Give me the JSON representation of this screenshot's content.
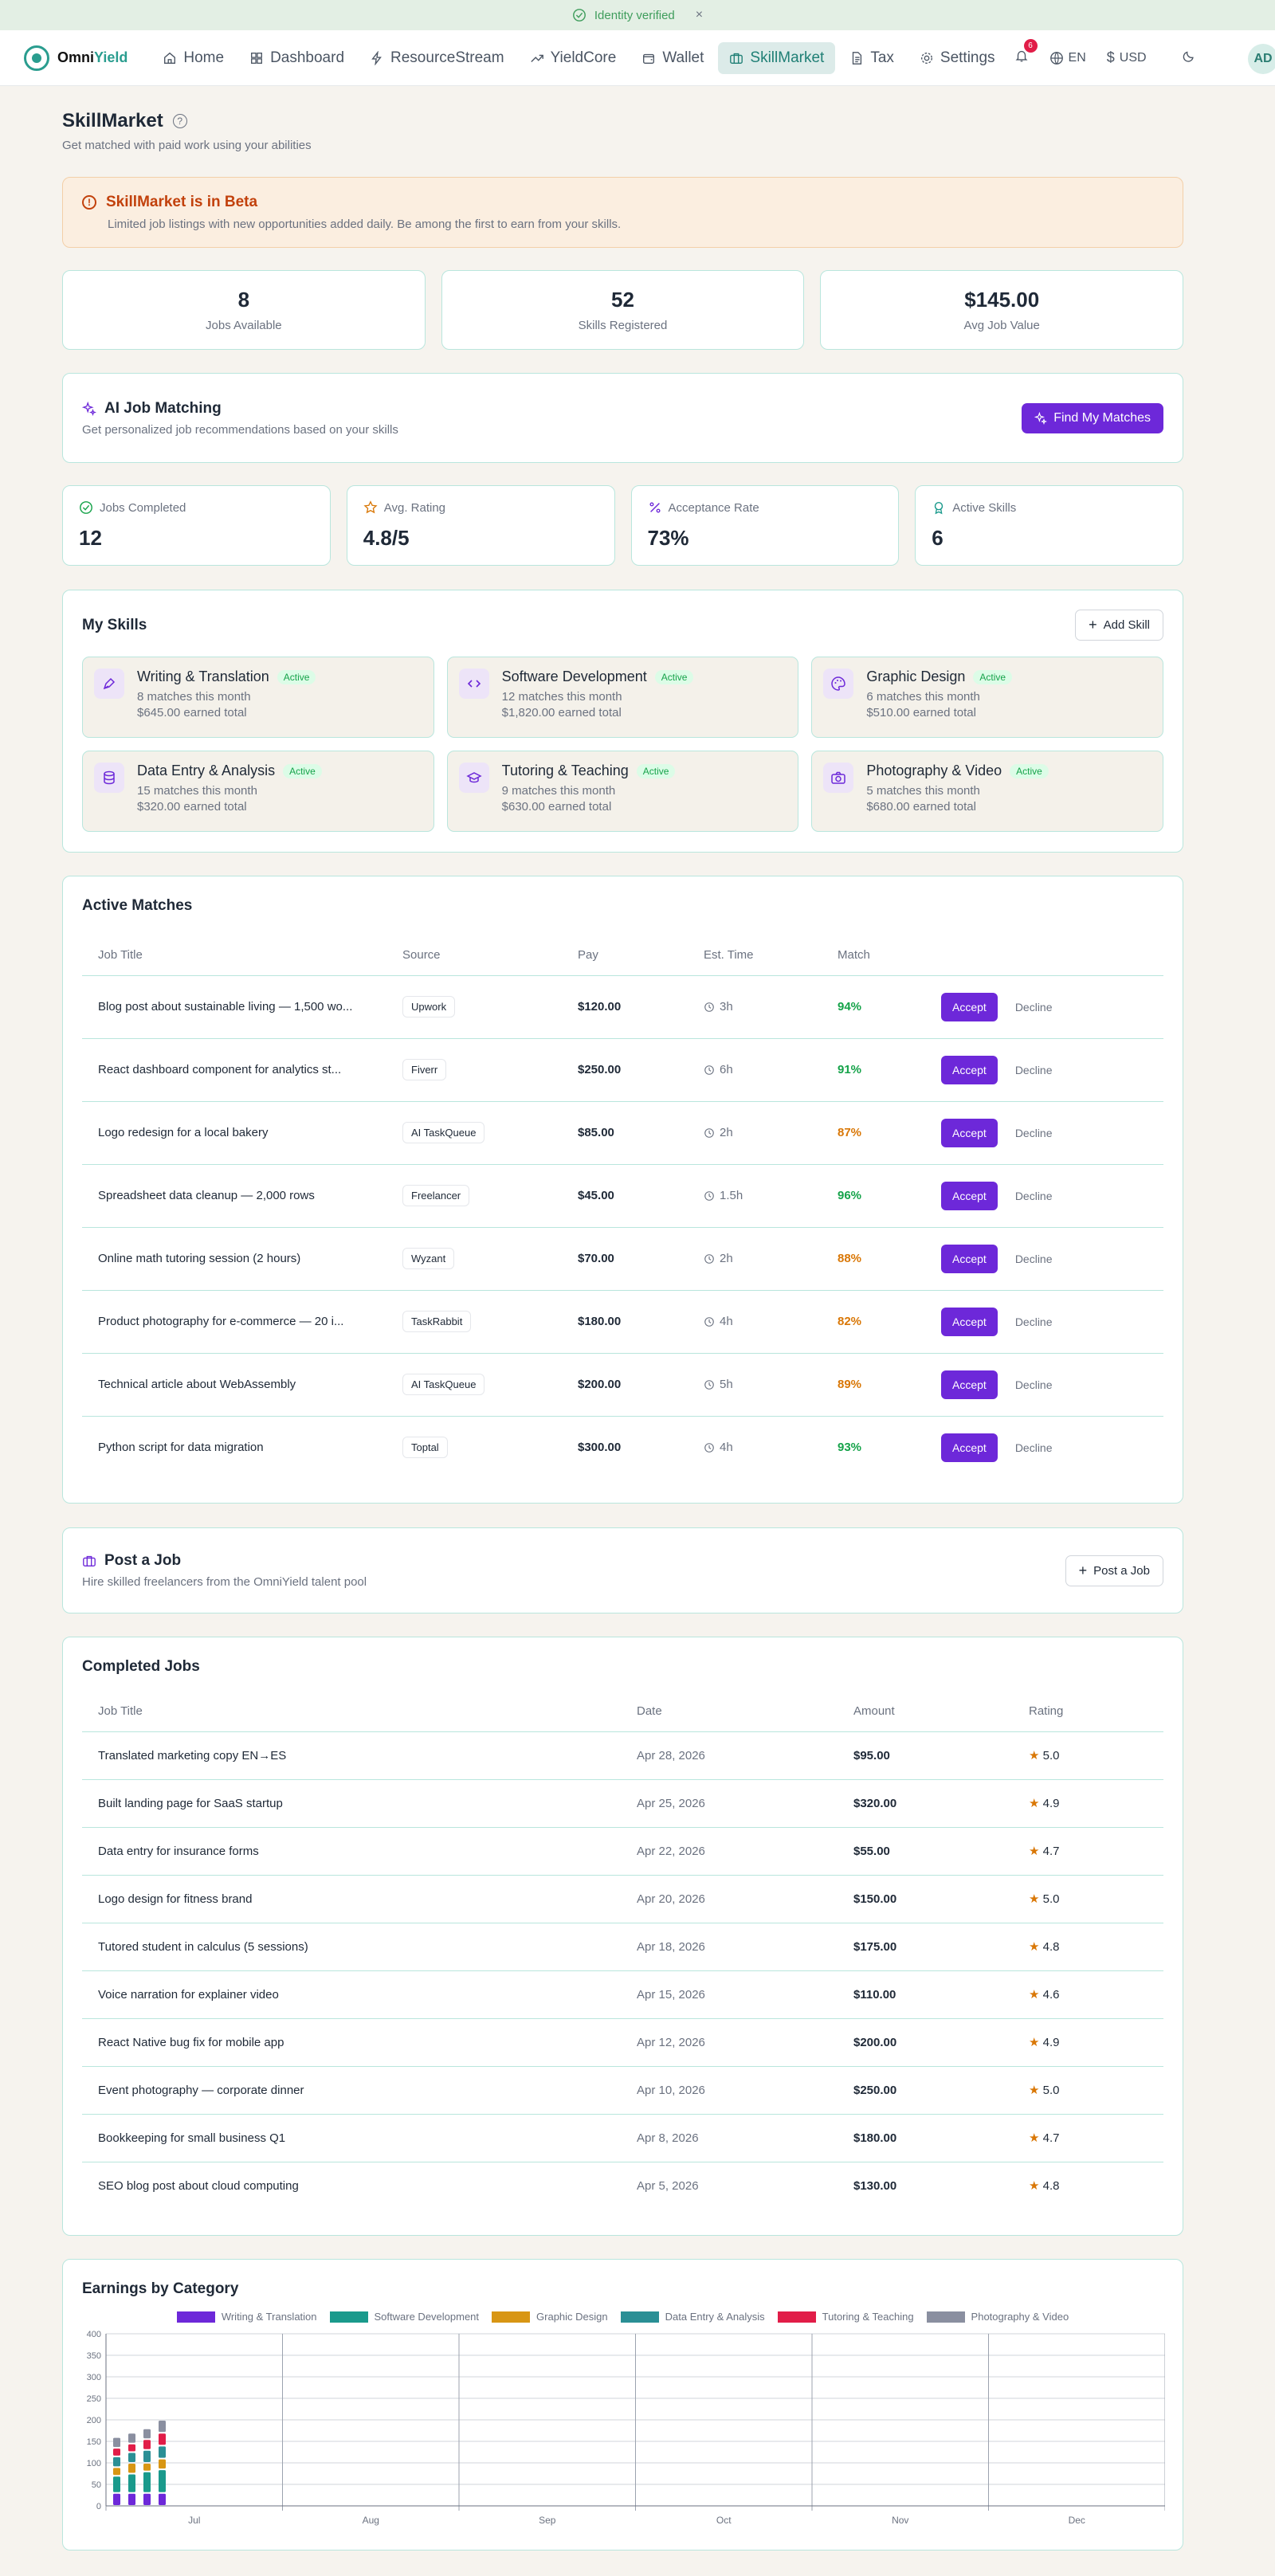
{
  "banner": {
    "text": "Identity verified",
    "close": "×"
  },
  "app": {
    "name_a": "Omni",
    "name_b": "Yield"
  },
  "nav": [
    {
      "label": "Home",
      "icon": "home-icon"
    },
    {
      "label": "Dashboard",
      "icon": "grid-icon"
    },
    {
      "label": "ResourceStream",
      "icon": "bolt-icon"
    },
    {
      "label": "YieldCore",
      "icon": "trend-icon"
    },
    {
      "label": "Wallet",
      "icon": "wallet-icon"
    },
    {
      "label": "SkillMarket",
      "icon": "briefcase-icon",
      "active": true
    },
    {
      "label": "Tax",
      "icon": "document-icon"
    },
    {
      "label": "Settings",
      "icon": "gear-icon"
    }
  ],
  "header_right": {
    "notifications": "6",
    "language": "EN",
    "currency": "USD",
    "avatar": "AD"
  },
  "page": {
    "title": "SkillMarket",
    "subtitle": "Get matched with paid work using your abilities"
  },
  "beta": {
    "title": "SkillMarket is in Beta",
    "text": "Limited job listings with new opportunities added daily. Be among the first to earn from your skills."
  },
  "summary": [
    {
      "value": "8",
      "label": "Jobs Available"
    },
    {
      "value": "52",
      "label": "Skills Registered"
    },
    {
      "value": "$145.00",
      "label": "Avg Job Value"
    }
  ],
  "ai": {
    "title": "AI Job Matching",
    "subtitle": "Get personalized job recommendations based on your skills",
    "button": "Find My Matches"
  },
  "kpis": [
    {
      "label": "Jobs Completed",
      "value": "12"
    },
    {
      "label": "Avg. Rating",
      "value": "4.8/5"
    },
    {
      "label": "Acceptance Rate",
      "value": "73%"
    },
    {
      "label": "Active Skills",
      "value": "6"
    }
  ],
  "skills": {
    "title": "My Skills",
    "add_button": "Add Skill",
    "items": [
      {
        "name": "Writing & Translation",
        "status": "Active",
        "matches": "8 matches this month",
        "earned": "$645.00 earned total",
        "icon": "pen-icon"
      },
      {
        "name": "Software Development",
        "status": "Active",
        "matches": "12 matches this month",
        "earned": "$1,820.00 earned total",
        "icon": "code-icon"
      },
      {
        "name": "Graphic Design",
        "status": "Active",
        "matches": "6 matches this month",
        "earned": "$510.00 earned total",
        "icon": "palette-icon"
      },
      {
        "name": "Data Entry & Analysis",
        "status": "Active",
        "matches": "15 matches this month",
        "earned": "$320.00 earned total",
        "icon": "database-icon"
      },
      {
        "name": "Tutoring & Teaching",
        "status": "Active",
        "matches": "9 matches this month",
        "earned": "$630.00 earned total",
        "icon": "graduation-cap-icon"
      },
      {
        "name": "Photography & Video",
        "status": "Active",
        "matches": "5 matches this month",
        "earned": "$680.00 earned total",
        "icon": "camera-icon"
      }
    ]
  },
  "matches": {
    "title": "Active Matches",
    "columns": [
      "Job Title",
      "Source",
      "Pay",
      "Est. Time",
      "Match"
    ],
    "accept": "Accept",
    "decline": "Decline",
    "rows": [
      {
        "title": "Blog post about sustainable living — 1,500 wo...",
        "source": "Upwork",
        "pay": "$120.00",
        "time": "3h",
        "match": "94%"
      },
      {
        "title": "React dashboard component for analytics st...",
        "source": "Fiverr",
        "pay": "$250.00",
        "time": "6h",
        "match": "91%"
      },
      {
        "title": "Logo redesign for a local bakery",
        "source": "AI TaskQueue",
        "pay": "$85.00",
        "time": "2h",
        "match": "87%"
      },
      {
        "title": "Spreadsheet data cleanup — 2,000 rows",
        "source": "Freelancer",
        "pay": "$45.00",
        "time": "1.5h",
        "match": "96%"
      },
      {
        "title": "Online math tutoring session (2 hours)",
        "source": "Wyzant",
        "pay": "$70.00",
        "time": "2h",
        "match": "88%"
      },
      {
        "title": "Product photography for e-commerce — 20 i...",
        "source": "TaskRabbit",
        "pay": "$180.00",
        "time": "4h",
        "match": "82%"
      },
      {
        "title": "Technical article about WebAssembly",
        "source": "AI TaskQueue",
        "pay": "$200.00",
        "time": "5h",
        "match": "89%"
      },
      {
        "title": "Python script for data migration",
        "source": "Toptal",
        "pay": "$300.00",
        "time": "4h",
        "match": "93%"
      }
    ]
  },
  "post": {
    "title": "Post a Job",
    "subtitle": "Hire skilled freelancers from the OmniYield talent pool",
    "button": "Post a Job"
  },
  "completed": {
    "title": "Completed Jobs",
    "columns": [
      "Job Title",
      "Date",
      "Amount",
      "Rating"
    ],
    "rows": [
      {
        "title": "Translated marketing copy EN→ES",
        "date": "Apr 28, 2026",
        "amount": "$95.00",
        "rating": "5.0"
      },
      {
        "title": "Built landing page for SaaS startup",
        "date": "Apr 25, 2026",
        "amount": "$320.00",
        "rating": "4.9"
      },
      {
        "title": "Data entry for insurance forms",
        "date": "Apr 22, 2026",
        "amount": "$55.00",
        "rating": "4.7"
      },
      {
        "title": "Logo design for fitness brand",
        "date": "Apr 20, 2026",
        "amount": "$150.00",
        "rating": "5.0"
      },
      {
        "title": "Tutored student in calculus (5 sessions)",
        "date": "Apr 18, 2026",
        "amount": "$175.00",
        "rating": "4.8"
      },
      {
        "title": "Voice narration for explainer video",
        "date": "Apr 15, 2026",
        "amount": "$110.00",
        "rating": "4.6"
      },
      {
        "title": "React Native bug fix for mobile app",
        "date": "Apr 12, 2026",
        "amount": "$200.00",
        "rating": "4.9"
      },
      {
        "title": "Event photography — corporate dinner",
        "date": "Apr 10, 2026",
        "amount": "$250.00",
        "rating": "5.0"
      },
      {
        "title": "Bookkeeping for small business Q1",
        "date": "Apr 8, 2026",
        "amount": "$180.00",
        "rating": "4.7"
      },
      {
        "title": "SEO blog post about cloud computing",
        "date": "Apr 5, 2026",
        "amount": "$130.00",
        "rating": "4.8"
      }
    ]
  },
  "chart_data": {
    "type": "bar",
    "title": "Earnings by Category",
    "stacked": true,
    "x_tick_labels": [
      "Jul",
      "Aug",
      "Sep",
      "Oct",
      "Nov",
      "Dec"
    ],
    "ylim": [
      0,
      400
    ],
    "y_ticks": [
      0,
      50,
      100,
      150,
      200,
      250,
      300,
      350,
      400
    ],
    "grid": true,
    "legend": "top-center",
    "bar_groups": 4,
    "series": [
      {
        "name": "Writing & Translation",
        "color": "#6d28d9",
        "values": [
          30,
          30,
          30,
          30
        ]
      },
      {
        "name": "Software Development",
        "color": "#1a9a8c",
        "values": [
          40,
          45,
          50,
          55
        ]
      },
      {
        "name": "Graphic Design",
        "color": "#d89614",
        "values": [
          20,
          25,
          20,
          25
        ]
      },
      {
        "name": "Data Entry & Analysis",
        "color": "#2a8f95",
        "values": [
          25,
          25,
          30,
          30
        ]
      },
      {
        "name": "Tutoring & Teaching",
        "color": "#e11d48",
        "values": [
          20,
          20,
          25,
          30
        ]
      },
      {
        "name": "Photography & Video",
        "color": "#8a8fa0",
        "values": [
          25,
          25,
          25,
          30
        ]
      }
    ]
  }
}
